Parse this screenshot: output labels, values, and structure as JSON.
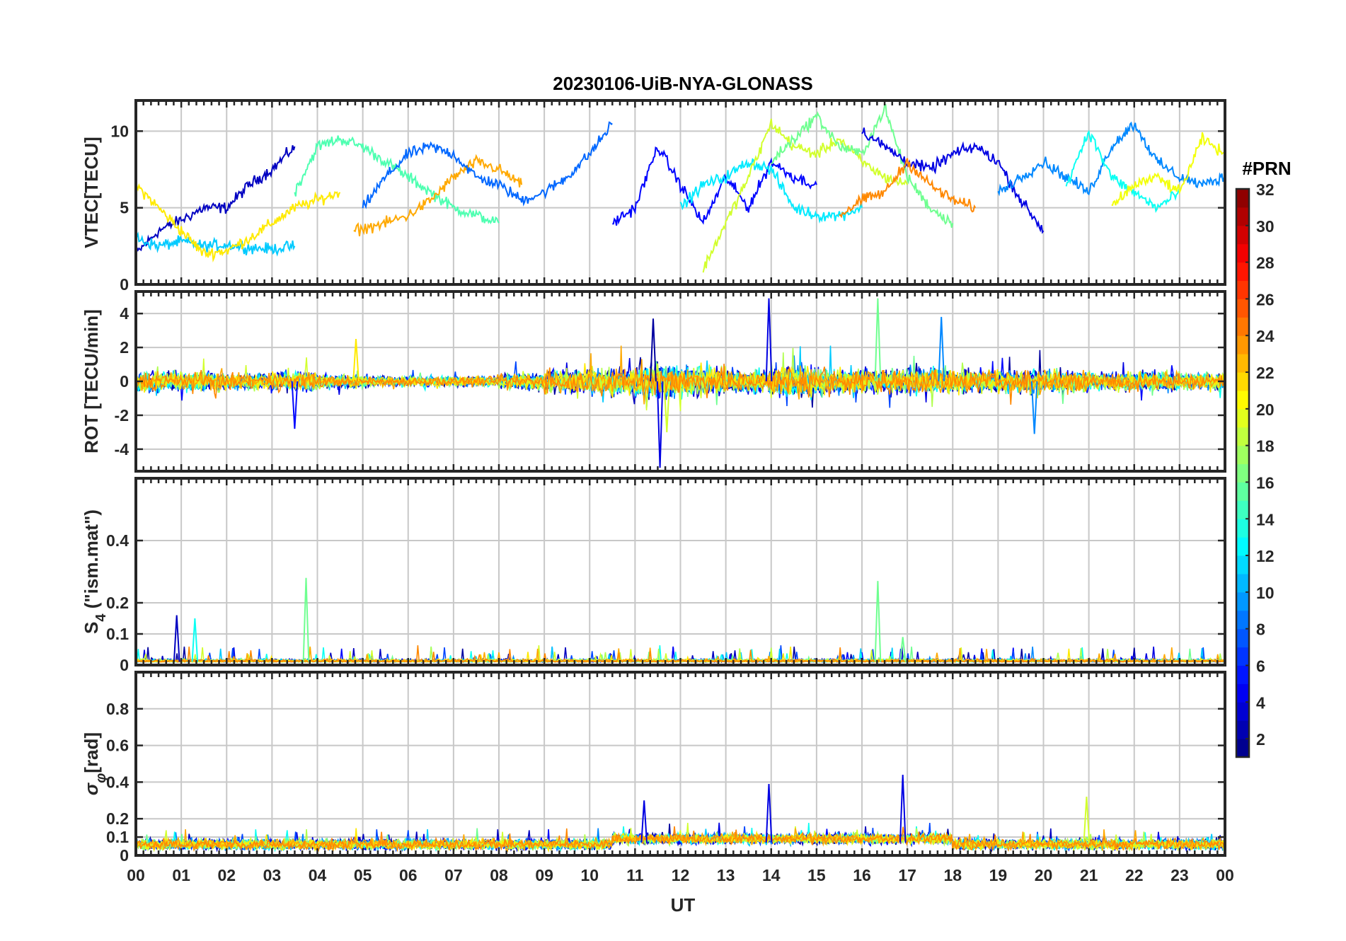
{
  "chart_data": [
    {
      "type": "line",
      "title": "20230106-UiB-NYA-GLONASS",
      "ylabel": "VTEC[TECU]",
      "xlabel": "",
      "xlim": [
        0,
        24
      ],
      "ylim": [
        0,
        12
      ],
      "yticks": [
        0,
        5,
        10
      ],
      "grid": true,
      "series_summary": "Multiple GLONASS PRN tracks, VTEC mostly between 2 and 11 TECU",
      "series": [
        {
          "prn": 3,
          "x": [
            0.0,
            0.5,
            1.0,
            1.5,
            2.0,
            2.5,
            3.0,
            3.5
          ],
          "y": [
            2.0,
            3.5,
            4.2,
            5.0,
            5.0,
            6.5,
            7.5,
            9.0
          ]
        },
        {
          "prn": 11,
          "x": [
            0.0,
            0.5,
            1.0,
            1.5,
            2.0,
            2.5,
            3.0,
            3.5
          ],
          "y": [
            3.0,
            2.5,
            2.8,
            2.5,
            2.6,
            2.4,
            2.3,
            2.5
          ]
        },
        {
          "prn": 21,
          "x": [
            0.0,
            0.5,
            1.0,
            1.5,
            2.0,
            2.5,
            3.0,
            3.5,
            4.0,
            4.5
          ],
          "y": [
            6.5,
            5.0,
            3.5,
            2.0,
            2.2,
            3.0,
            4.0,
            5.0,
            5.5,
            6.0
          ]
        },
        {
          "prn": 15,
          "x": [
            3.5,
            4.0,
            4.5,
            5.0,
            5.5,
            6.0,
            6.5,
            7.0,
            7.5,
            8.0
          ],
          "y": [
            6.0,
            9.0,
            9.5,
            9.0,
            8.0,
            7.0,
            6.0,
            5.0,
            4.5,
            4.0
          ]
        },
        {
          "prn": 23,
          "x": [
            4.8,
            5.5,
            6.0,
            6.5,
            7.0,
            7.5,
            8.0,
            8.5
          ],
          "y": [
            3.5,
            4.0,
            4.5,
            5.5,
            7.0,
            8.0,
            7.5,
            6.5
          ]
        },
        {
          "prn": 8,
          "x": [
            5.0,
            5.5,
            6.0,
            6.5,
            7.0,
            7.5,
            8.0,
            8.5,
            9.0,
            9.5,
            10.0,
            10.5
          ],
          "y": [
            5.0,
            7.0,
            8.5,
            9.0,
            8.5,
            7.0,
            6.5,
            5.5,
            6.0,
            7.0,
            8.5,
            10.5
          ]
        },
        {
          "prn": 5,
          "x": [
            10.5,
            11.0,
            11.5,
            12.0,
            12.5,
            13.0,
            13.5,
            14.0,
            14.5,
            15.0
          ],
          "y": [
            4.0,
            5.0,
            9.0,
            6.5,
            4.0,
            7.0,
            5.0,
            8.0,
            7.0,
            6.5
          ]
        },
        {
          "prn": 12,
          "x": [
            12.0,
            12.5,
            13.0,
            13.5,
            14.0,
            14.5,
            15.0,
            15.5,
            16.0
          ],
          "y": [
            5.0,
            6.5,
            7.0,
            8.0,
            7.5,
            5.0,
            4.5,
            4.5,
            5.0
          ]
        },
        {
          "prn": 19,
          "x": [
            12.5,
            13.0,
            13.5,
            14.0,
            14.5,
            15.0,
            15.5,
            16.0,
            16.5,
            17.0
          ],
          "y": [
            1.0,
            4.0,
            7.0,
            10.5,
            9.0,
            8.5,
            9.5,
            8.0,
            7.0,
            6.5
          ]
        },
        {
          "prn": 16,
          "x": [
            14.0,
            14.5,
            15.0,
            15.5,
            16.0,
            16.5,
            17.0,
            17.5,
            18.0
          ],
          "y": [
            8.0,
            9.5,
            11.0,
            9.0,
            8.5,
            11.5,
            7.0,
            5.0,
            4.0
          ]
        },
        {
          "prn": 4,
          "x": [
            16.0,
            16.5,
            17.0,
            17.5,
            18.0,
            18.5,
            19.0,
            19.5,
            20.0
          ],
          "y": [
            10.0,
            9.0,
            8.0,
            7.5,
            8.5,
            9.0,
            8.0,
            5.5,
            3.5
          ]
        },
        {
          "prn": 24,
          "x": [
            15.5,
            16.0,
            16.5,
            17.0,
            17.5,
            18.0,
            18.5
          ],
          "y": [
            4.5,
            5.5,
            6.0,
            8.0,
            6.5,
            5.5,
            5.0
          ]
        },
        {
          "prn": 9,
          "x": [
            19.0,
            19.5,
            20.0,
            20.5,
            21.0,
            21.5,
            22.0,
            22.5,
            23.0,
            23.5,
            24.0
          ],
          "y": [
            6.0,
            7.0,
            8.0,
            7.0,
            6.0,
            9.0,
            10.5,
            8.0,
            7.0,
            6.5,
            7.0
          ]
        },
        {
          "prn": 13,
          "x": [
            20.5,
            21.0,
            21.5,
            22.0,
            22.5,
            23.0
          ],
          "y": [
            6.5,
            10.0,
            7.0,
            6.0,
            5.0,
            6.0
          ]
        },
        {
          "prn": 20,
          "x": [
            21.5,
            22.0,
            22.5,
            23.0,
            23.5,
            24.0
          ],
          "y": [
            5.0,
            6.5,
            7.0,
            6.0,
            9.5,
            8.5
          ]
        }
      ]
    },
    {
      "type": "line",
      "title": "",
      "ylabel": "ROT [TECU/min]",
      "xlabel": "",
      "xlim": [
        0,
        24
      ],
      "ylim": [
        -5.3,
        5.3
      ],
      "yticks": [
        -4,
        -2,
        0,
        2,
        4
      ],
      "grid": true,
      "noise_amplitude_by_hour": [
        0.6,
        0.6,
        0.5,
        0.6,
        0.4,
        0.3,
        0.3,
        0.3,
        0.5,
        0.7,
        0.8,
        1.1,
        0.9,
        0.7,
        1.0,
        0.8,
        0.8,
        0.8,
        0.7,
        0.7,
        0.7,
        0.6,
        0.6,
        0.5
      ],
      "spikes": [
        {
          "x": 11.55,
          "y": -5.1,
          "prn": 4
        },
        {
          "x": 11.4,
          "y": 3.7,
          "prn": 2
        },
        {
          "x": 13.95,
          "y": 4.9,
          "prn": 4
        },
        {
          "x": 16.35,
          "y": 4.9,
          "prn": 16
        },
        {
          "x": 17.75,
          "y": 3.8,
          "prn": 9
        },
        {
          "x": 19.8,
          "y": -3.1,
          "prn": 9
        },
        {
          "x": 3.5,
          "y": -2.8,
          "prn": 5
        },
        {
          "x": 4.85,
          "y": 2.5,
          "prn": 21
        },
        {
          "x": 11.7,
          "y": -3.0,
          "prn": 19
        }
      ]
    },
    {
      "type": "line",
      "title": "",
      "ylabel": "S_4 (\"ism.mat\")",
      "ylabel_main": "S",
      "ylabel_sub": "4",
      "ylabel_rest": " (\"ism.mat\")",
      "xlabel": "",
      "xlim": [
        0,
        24
      ],
      "ylim": [
        0,
        0.6
      ],
      "yticks": [
        0,
        0.1,
        0.2,
        0.4
      ],
      "grid": true,
      "baseline": 0.01,
      "spikes": [
        {
          "x": 0.9,
          "y": 0.16,
          "prn": 3
        },
        {
          "x": 1.3,
          "y": 0.15,
          "prn": 13
        },
        {
          "x": 3.75,
          "y": 0.28,
          "prn": 16
        },
        {
          "x": 16.35,
          "y": 0.27,
          "prn": 16
        },
        {
          "x": 16.9,
          "y": 0.09,
          "prn": 16
        }
      ]
    },
    {
      "type": "line",
      "title": "",
      "ylabel": "σ_φ[rad]",
      "ylabel_main": "σ",
      "ylabel_sub": "φ",
      "ylabel_rest": "[rad]",
      "xlabel": "UT",
      "xlim": [
        0,
        24
      ],
      "ylim": [
        0,
        1.0
      ],
      "yticks": [
        0,
        0.1,
        0.2,
        0.4,
        0.6,
        0.8
      ],
      "grid": true,
      "baseline": 0.07,
      "spikes": [
        {
          "x": 13.95,
          "y": 0.39,
          "prn": 4
        },
        {
          "x": 16.9,
          "y": 0.44,
          "prn": 4
        },
        {
          "x": 20.95,
          "y": 0.32,
          "prn": 19
        },
        {
          "x": 11.2,
          "y": 0.3,
          "prn": 4
        }
      ]
    }
  ],
  "x_tick_labels": [
    "00",
    "01",
    "02",
    "03",
    "04",
    "05",
    "06",
    "07",
    "08",
    "09",
    "10",
    "11",
    "12",
    "13",
    "14",
    "15",
    "16",
    "17",
    "18",
    "19",
    "20",
    "21",
    "22",
    "23",
    "00"
  ],
  "colorbar": {
    "title": "#PRN",
    "min": 1,
    "max": 32,
    "ticks": [
      2,
      4,
      6,
      8,
      10,
      12,
      14,
      16,
      18,
      20,
      22,
      24,
      26,
      28,
      30,
      32
    ],
    "colormap": "jet"
  }
}
